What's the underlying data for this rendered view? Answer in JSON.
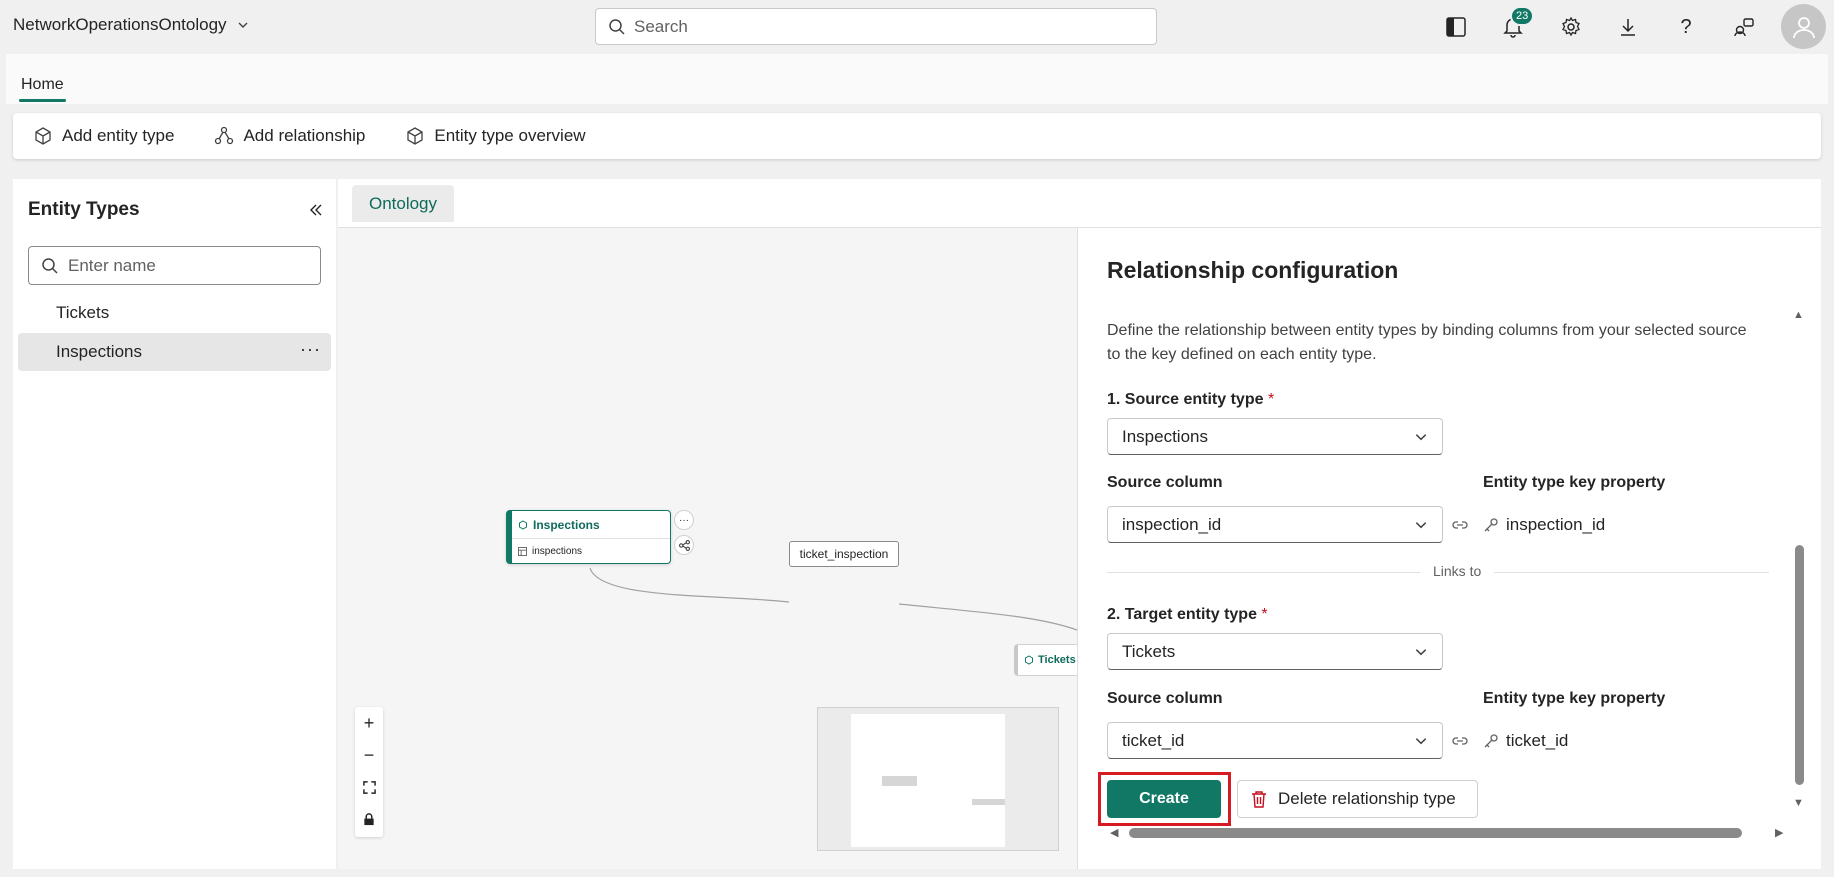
{
  "header": {
    "workspace_title": "NetworkOperationsOntology",
    "search_placeholder": "Search",
    "notifications_count": "23"
  },
  "ribbon": {
    "home_tab": "Home",
    "add_entity_type": "Add entity type",
    "add_relationship": "Add relationship",
    "entity_type_overview": "Entity type overview"
  },
  "sidebar": {
    "title": "Entity Types",
    "search_placeholder": "Enter name",
    "items": [
      {
        "label": "Tickets",
        "selected": false
      },
      {
        "label": "Inspections",
        "selected": true
      }
    ]
  },
  "canvas": {
    "tab": "Ontology",
    "node_inspections": {
      "title": "Inspections",
      "source": "inspections"
    },
    "edge_label": "ticket_inspection",
    "node_tickets": {
      "title": "Tickets"
    },
    "zoom_in": "+",
    "zoom_out": "−"
  },
  "config": {
    "title": "Relationship configuration",
    "description": "Define the relationship between entity types by binding columns from your selected source to the key defined on each entity type.",
    "source_entity_label": "1. Source entity type",
    "source_entity_value": "Inspections",
    "source_column_label": "Source column",
    "source_column_value": "inspection_id",
    "source_key_label": "Entity type key property",
    "source_key_value": "inspection_id",
    "links_to": "Links to",
    "target_entity_label": "2. Target entity type",
    "target_entity_value": "Tickets",
    "target_column_label": "Source column",
    "target_column_value": "ticket_id",
    "target_key_label": "Entity type key property",
    "target_key_value": "ticket_id",
    "required_marker": "*",
    "create_button": "Create",
    "delete_button": "Delete relationship type"
  },
  "colors": {
    "accent": "#117865",
    "highlight_box": "#d71921"
  }
}
